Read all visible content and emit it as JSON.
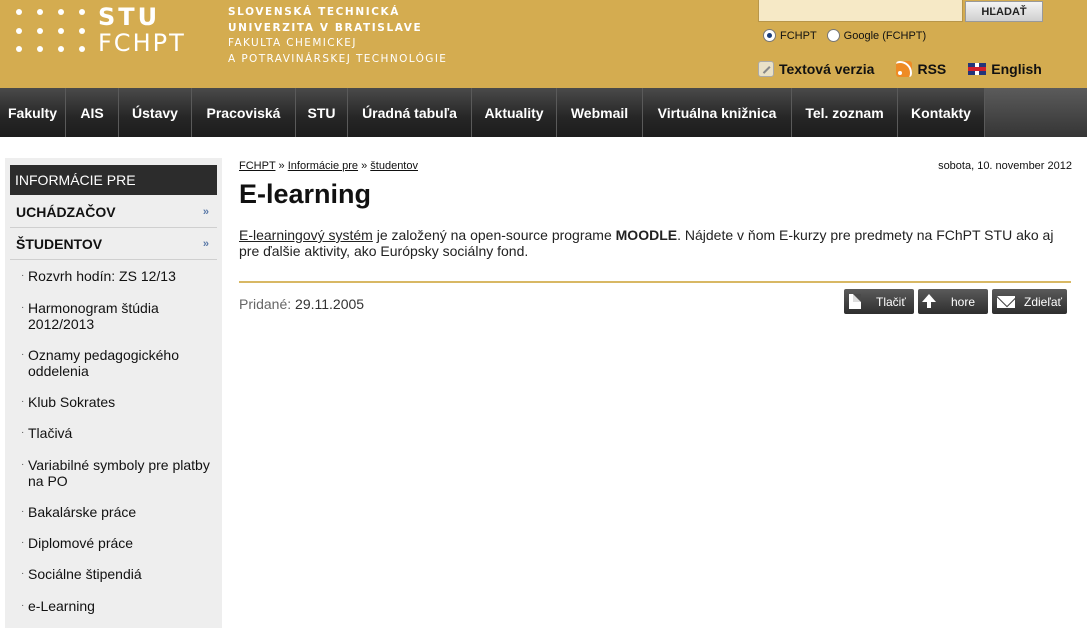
{
  "header": {
    "logo_line1": "STU",
    "logo_line2": "FCHPT",
    "school_line1": "SLOVENSKÁ TECHNICKÁ",
    "school_line2": "UNIVERZITA V BRATISLAVE",
    "school_line3": "FAKULTA CHEMICKEJ",
    "school_line4": "A POTRAVINÁRSKEJ TECHNOLÓGIE",
    "search": {
      "value": "",
      "button_label": "HĽADAŤ"
    },
    "radios": [
      {
        "label": "FCHPT",
        "checked": true
      },
      {
        "label": "Google (FCHPT)",
        "checked": false
      }
    ],
    "links": {
      "text_version": "Textová verzia",
      "rss": "RSS",
      "english": "English"
    }
  },
  "nav": {
    "items": [
      "Fakulty",
      "AIS",
      "Ústavy",
      "Pracoviská",
      "STU",
      "Úradná tabuľa",
      "Aktuality",
      "Webmail",
      "Virtuálna knižnica",
      "Tel. zoznam",
      "Kontakty"
    ]
  },
  "sidebar": {
    "heading": "INFORMÁCIE PRE",
    "categories": [
      "UCHÁDZAČOV",
      "ŠTUDENTOV"
    ],
    "subitems": [
      "Rozvrh hodín: ZS 12/13",
      "Harmonogram štúdia 2012/2013",
      "Oznamy pedagogického oddelenia",
      "Klub Sokrates",
      "Tlačivá",
      "Variabilné symboly pre platby na PO",
      "Bakalárske práce",
      "Diplomové práce",
      "Sociálne štipendiá",
      "e-Learning"
    ]
  },
  "main": {
    "breadcrumb": [
      "FCHPT",
      "Informácie pre",
      "študentov"
    ],
    "breadcrumb_sep": "»",
    "date": "sobota, 10. november 2012",
    "title": "E-learning",
    "body": {
      "link": "E-learningový systém",
      "part1": " je založený na open-source programe ",
      "bold": "MOODLE",
      "part2": ". Nájdete v ňom E-kurzy pre predmety na FChPT STU ako aj pre ďalšie aktivity, ako Európsky sociálny fond."
    },
    "added_label": "Pridané:",
    "added_value": "29.11.2005",
    "buttons": {
      "print": "Tlačiť",
      "top": "hore",
      "share": "Zdieľať"
    }
  }
}
